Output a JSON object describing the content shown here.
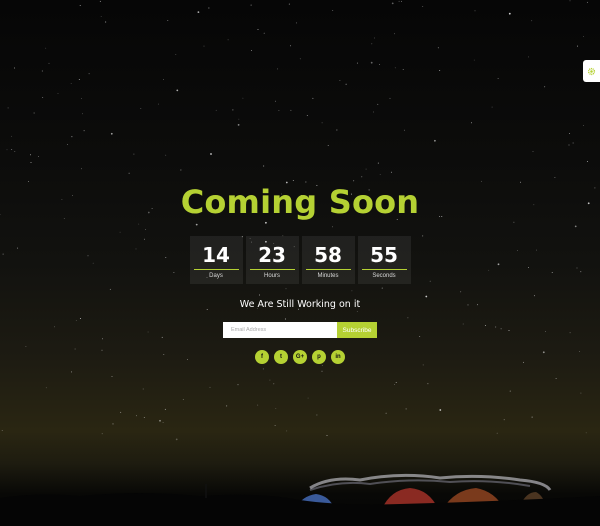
{
  "page": {
    "title": "Coming Soon",
    "subtitle": "We Are Still Working on it"
  },
  "countdown": [
    {
      "value": "14",
      "label": "Days"
    },
    {
      "value": "23",
      "label": "Hours"
    },
    {
      "value": "58",
      "label": "Minutes"
    },
    {
      "value": "55",
      "label": "Seconds"
    }
  ],
  "subscribe": {
    "placeholder": "Email Address",
    "button_label": "Subscribe"
  },
  "social": [
    {
      "icon": "facebook-icon",
      "glyph": "f"
    },
    {
      "icon": "twitter-icon",
      "glyph": "t"
    },
    {
      "icon": "google-plus-icon",
      "glyph": "G+"
    },
    {
      "icon": "pinterest-icon",
      "glyph": "p"
    },
    {
      "icon": "linkedin-icon",
      "glyph": "in"
    }
  ],
  "settings": {
    "icon": "gear-icon"
  },
  "colors": {
    "accent": "#b5d133",
    "background": "#0a0a0a",
    "text": "#ffffff"
  }
}
